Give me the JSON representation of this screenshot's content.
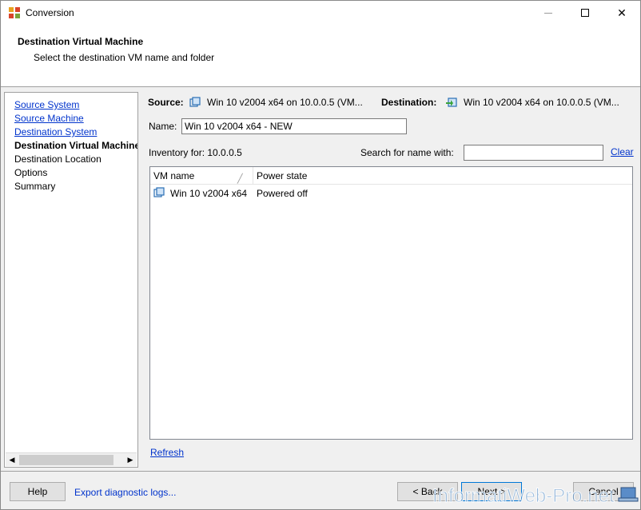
{
  "window": {
    "title": "Conversion"
  },
  "header": {
    "title": "Destination Virtual Machine",
    "subtitle": "Select the destination VM name and folder"
  },
  "nav": {
    "items": [
      {
        "label": "Source System",
        "state": "link"
      },
      {
        "label": "Source Machine",
        "state": "link"
      },
      {
        "label": "Destination System",
        "state": "link"
      },
      {
        "label": "Destination Virtual Machine",
        "state": "current"
      },
      {
        "label": "Destination Location",
        "state": "pending"
      },
      {
        "label": "Options",
        "state": "pending"
      },
      {
        "label": "Summary",
        "state": "pending"
      }
    ]
  },
  "source": {
    "label": "Source:",
    "value": "Win 10 v2004 x64 on 10.0.0.5 (VM..."
  },
  "destination": {
    "label": "Destination:",
    "value": "Win 10 v2004 x64 on 10.0.0.5 (VM..."
  },
  "name_field": {
    "label": "Name:",
    "value": "Win 10 v2004 x64 - NEW"
  },
  "inventory": {
    "label": "Inventory for:",
    "value": "10.0.0.5"
  },
  "search": {
    "label": "Search for name with:",
    "value": "",
    "clear_label": "Clear"
  },
  "table": {
    "columns": [
      "VM name",
      "Power state"
    ],
    "rows": [
      {
        "vm_name": "Win 10 v2004 x64",
        "power_state": "Powered off"
      }
    ]
  },
  "refresh_label": "Refresh",
  "footer": {
    "help_label": "Help",
    "export_label": "Export diagnostic logs...",
    "back_label": "< Back",
    "next_label": "Next >",
    "cancel_label": "Cancel"
  },
  "watermark": "InformatiWeb-Pro.net",
  "colors": {
    "link": "#0033cc",
    "accent": "#0078d7",
    "header_bg": "#ffffff",
    "body_bg": "#f0f0f0"
  }
}
